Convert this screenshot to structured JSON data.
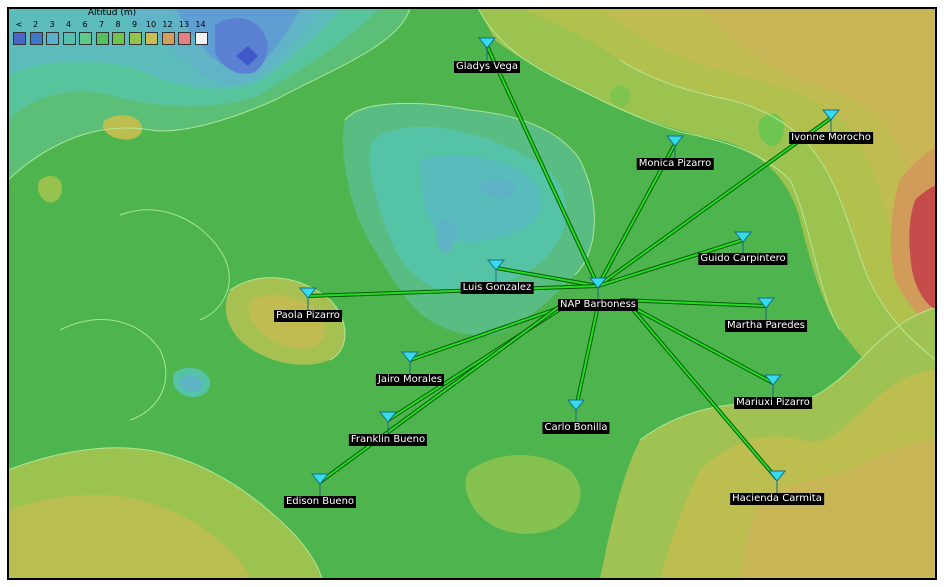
{
  "legend": {
    "title": "Altitud (m)",
    "ticks": [
      "<",
      "2",
      "3",
      "4",
      "6",
      "7",
      "8",
      "9",
      "10",
      "12",
      "13",
      "14"
    ],
    "colors": [
      "#4a66c8",
      "#3f78c8",
      "#58b0cc",
      "#55c0b0",
      "#60c888",
      "#52c05e",
      "#6cc44e",
      "#98c24e",
      "#c8bc54",
      "#d2a05a",
      "#e28282",
      "#f2f2f2"
    ]
  },
  "map": {
    "link_color": "#22dd22",
    "site_color": "#33ddee",
    "hub_label": "NAP Barboness"
  },
  "sites": [
    {
      "id": "nap",
      "name": "NAP Barboness"
    },
    {
      "id": "gladys",
      "name": "Gladys Vega"
    },
    {
      "id": "monica",
      "name": "Monica Pizarro"
    },
    {
      "id": "ivonne",
      "name": "Ivonne Morocho"
    },
    {
      "id": "guido",
      "name": "Guido Carpintero"
    },
    {
      "id": "luis",
      "name": "Luis Gonzalez"
    },
    {
      "id": "paola",
      "name": "Paola Pizarro"
    },
    {
      "id": "martha",
      "name": "Martha Paredes"
    },
    {
      "id": "jairo",
      "name": "Jairo Morales"
    },
    {
      "id": "mariuxi",
      "name": "Mariuxi Pizarro"
    },
    {
      "id": "carlo",
      "name": "Carlo Bonilla"
    },
    {
      "id": "franklin",
      "name": "Franklin Bueno"
    },
    {
      "id": "edison",
      "name": "Edison Bueno"
    },
    {
      "id": "hacienda",
      "name": "Hacienda Carmita"
    }
  ]
}
